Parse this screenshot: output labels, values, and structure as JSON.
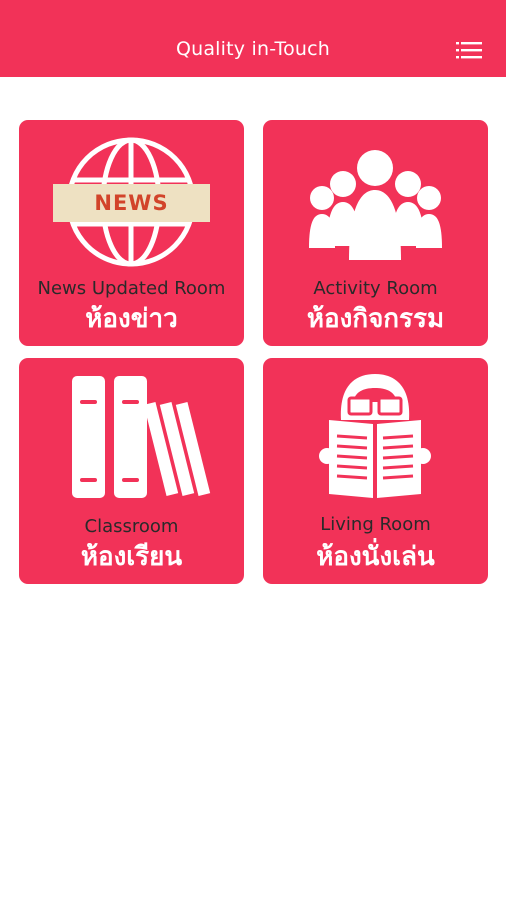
{
  "app": {
    "title": "Quality in-Touch",
    "accent_color": "#f23258",
    "menu_icon": "hamburger-menu-icon"
  },
  "rooms": [
    {
      "english": "News Updated Room",
      "thai": "ห้องข่าว",
      "icon": "news-globe-icon",
      "badge": "NEWS"
    },
    {
      "english": "Activity Room",
      "thai": "ห้องกิจกรรม",
      "icon": "people-group-icon"
    },
    {
      "english": "Classroom",
      "thai": "ห้องเรียน",
      "icon": "books-icon"
    },
    {
      "english": "Living Room",
      "thai": "ห้องนั่งเล่น",
      "icon": "reading-newspaper-icon"
    }
  ]
}
